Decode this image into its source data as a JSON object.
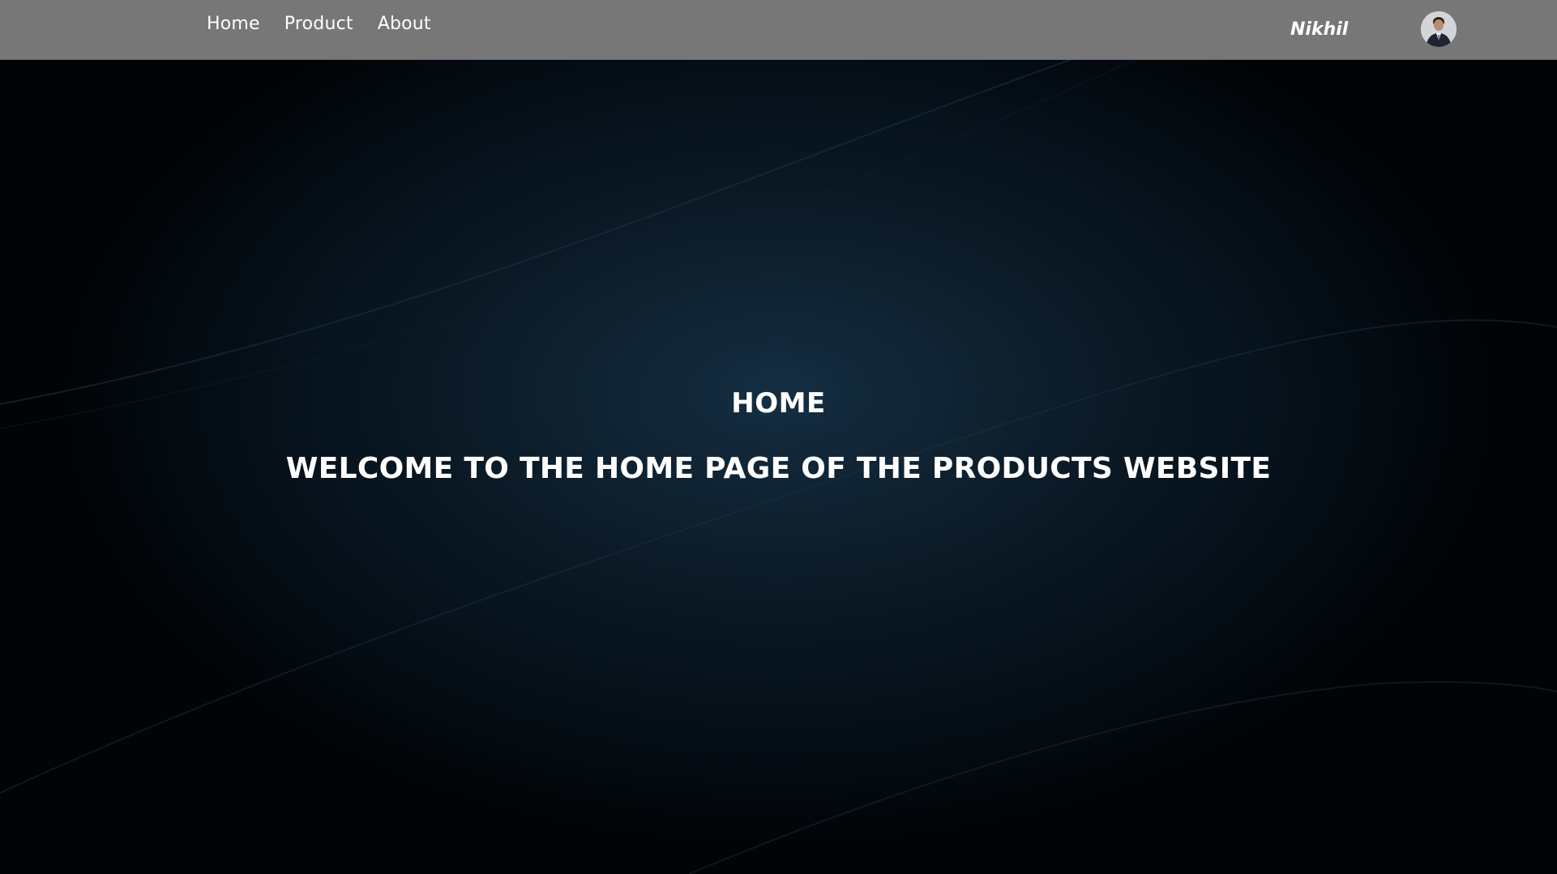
{
  "navbar": {
    "links": [
      {
        "label": "Home"
      },
      {
        "label": "Product"
      },
      {
        "label": "About"
      }
    ],
    "user_name": "Nikhil",
    "background_color": "#777777"
  },
  "hero": {
    "title": "HOME",
    "subtitle": "WELCOME TO THE HOME PAGE OF THE PRODUCTS WEBSITE",
    "background_color": "#0b1a26",
    "text_color": "#ffffff"
  },
  "icons": {
    "avatar": "user-avatar-photo"
  }
}
